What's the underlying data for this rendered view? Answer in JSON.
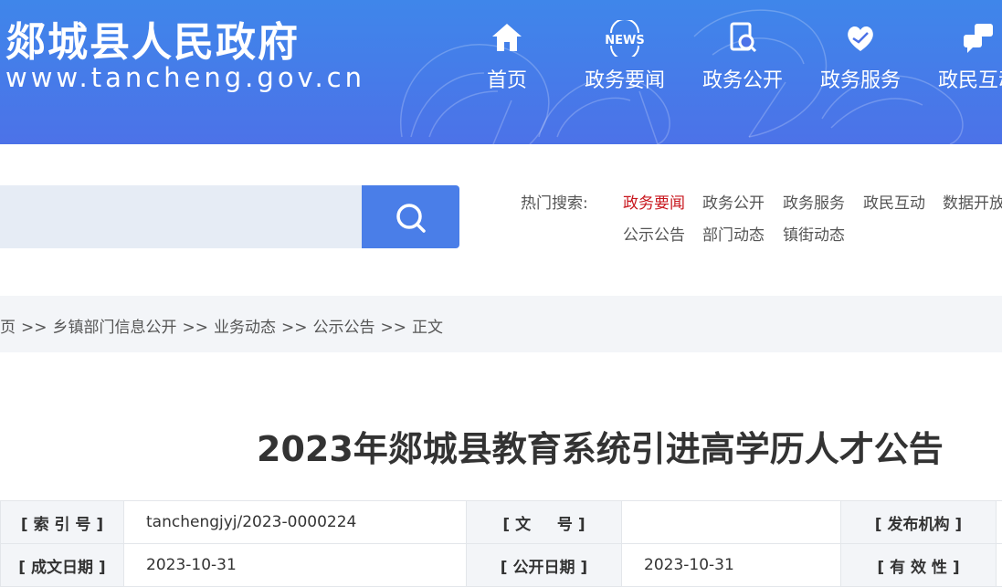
{
  "site": {
    "title": "郯城县人民政府",
    "url": "www.tancheng.gov.cn"
  },
  "nav": [
    {
      "label": "首页",
      "icon": "home-icon"
    },
    {
      "label": "政务要闻",
      "icon": "news-icon"
    },
    {
      "label": "政务公开",
      "icon": "document-search-icon"
    },
    {
      "label": "政务服务",
      "icon": "heart-hands-icon"
    },
    {
      "label": "政民互动",
      "icon": "chat-bubbles-icon"
    }
  ],
  "nav_news_badge": "NEWS",
  "search": {
    "placeholder": "",
    "button_icon": "search-icon"
  },
  "hot": {
    "label": "热门搜索:",
    "keywords": [
      "政务要闻",
      "政务公开",
      "政务服务",
      "政民互动",
      "数据开放",
      "公示公告",
      "部门动态",
      "镇街动态"
    ]
  },
  "breadcrumb": {
    "items": [
      "页",
      "乡镇部门信息公开",
      "业务动态",
      "公示公告",
      "正文"
    ],
    "separator": ">>"
  },
  "article": {
    "title": "2023年郯城县教育系统引进高学历人才公告"
  },
  "meta": {
    "index_label": "[ 索 引 号 ]",
    "index_value": "tanchengjyj/2023-0000224",
    "docno_label": "[ 文 　 号 ]",
    "docno_value": "",
    "publisher_label": "[ 发布机构 ]",
    "publisher_value": "",
    "created_label": "[ 成文日期 ]",
    "created_value": "2023-10-31",
    "opened_label": "[ 公开日期 ]",
    "opened_value": "2023-10-31",
    "validity_label": "[ 有 效 性 ]",
    "validity_value": ""
  },
  "colors": {
    "header_blue": "#4c72e8",
    "search_button": "#4a7ee8",
    "hot_active": "#c8161d",
    "breadcrumb_bg": "#f3f5f8"
  }
}
